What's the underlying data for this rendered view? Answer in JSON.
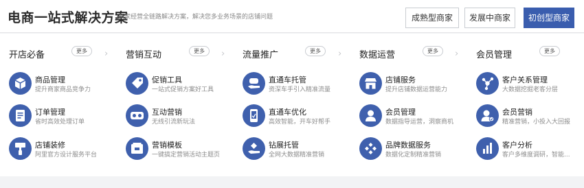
{
  "header": {
    "title": "电商一站式解决方案",
    "subtitle": "商家经营全链路解决方案，解决您多业务场景的店铺问题",
    "tabs": [
      {
        "label": "成熟型商家",
        "active": false
      },
      {
        "label": "发展中商家",
        "active": false
      },
      {
        "label": "初创型商家",
        "active": true
      }
    ]
  },
  "more_label": "更多",
  "columns": [
    {
      "title": "开店必备",
      "items": [
        {
          "title": "商品管理",
          "desc": "提升商家商品竞争力",
          "icon": "box-icon"
        },
        {
          "title": "订单管理",
          "desc": "省时高效处理订单",
          "icon": "order-list-icon"
        },
        {
          "title": "店铺装修",
          "desc": "阿里官方设计服务平台",
          "icon": "brush-icon"
        }
      ]
    },
    {
      "title": "营销互动",
      "items": [
        {
          "title": "促销工具",
          "desc": "一站式促销方案好工具",
          "icon": "price-tag-icon"
        },
        {
          "title": "互动营销",
          "desc": "无线引流新玩法",
          "icon": "vr-glasses-icon"
        },
        {
          "title": "营销模板",
          "desc": "一键搞定营销活动主题页",
          "icon": "template-icon"
        }
      ]
    },
    {
      "title": "流量推广",
      "items": [
        {
          "title": "直通车托管",
          "desc": "资深车手引入精准流量",
          "icon": "car-hand-icon"
        },
        {
          "title": "直通车优化",
          "desc": "高效智能，开车好帮手",
          "icon": "phone-optimize-icon"
        },
        {
          "title": "钻展托管",
          "desc": "全网大数据精准营销",
          "icon": "diamond-hand-icon"
        }
      ]
    },
    {
      "title": "数据运营",
      "items": [
        {
          "title": "店铺服务",
          "desc": "提升店铺数据运营能力",
          "icon": "storefront-icon"
        },
        {
          "title": "会员管理",
          "desc": "数据指导运营，洞察商机",
          "icon": "member-icon"
        },
        {
          "title": "品牌数据服务",
          "desc": "数据化定制精准营销",
          "icon": "puzzle-icon"
        }
      ]
    },
    {
      "title": "会员管理",
      "items": [
        {
          "title": "客户关系管理",
          "desc": "大数据挖掘老客分层",
          "icon": "network-icon"
        },
        {
          "title": "会员营销",
          "desc": "精准营销，小投入大回报",
          "icon": "member-badge-icon"
        },
        {
          "title": "客户分析",
          "desc": "客户多维度调研，智能...",
          "icon": "bar-chart-icon"
        }
      ]
    }
  ],
  "colors": {
    "accent": "#3a5dae",
    "icon_bg": "#3f60ad",
    "background": "#f2f3f5"
  }
}
